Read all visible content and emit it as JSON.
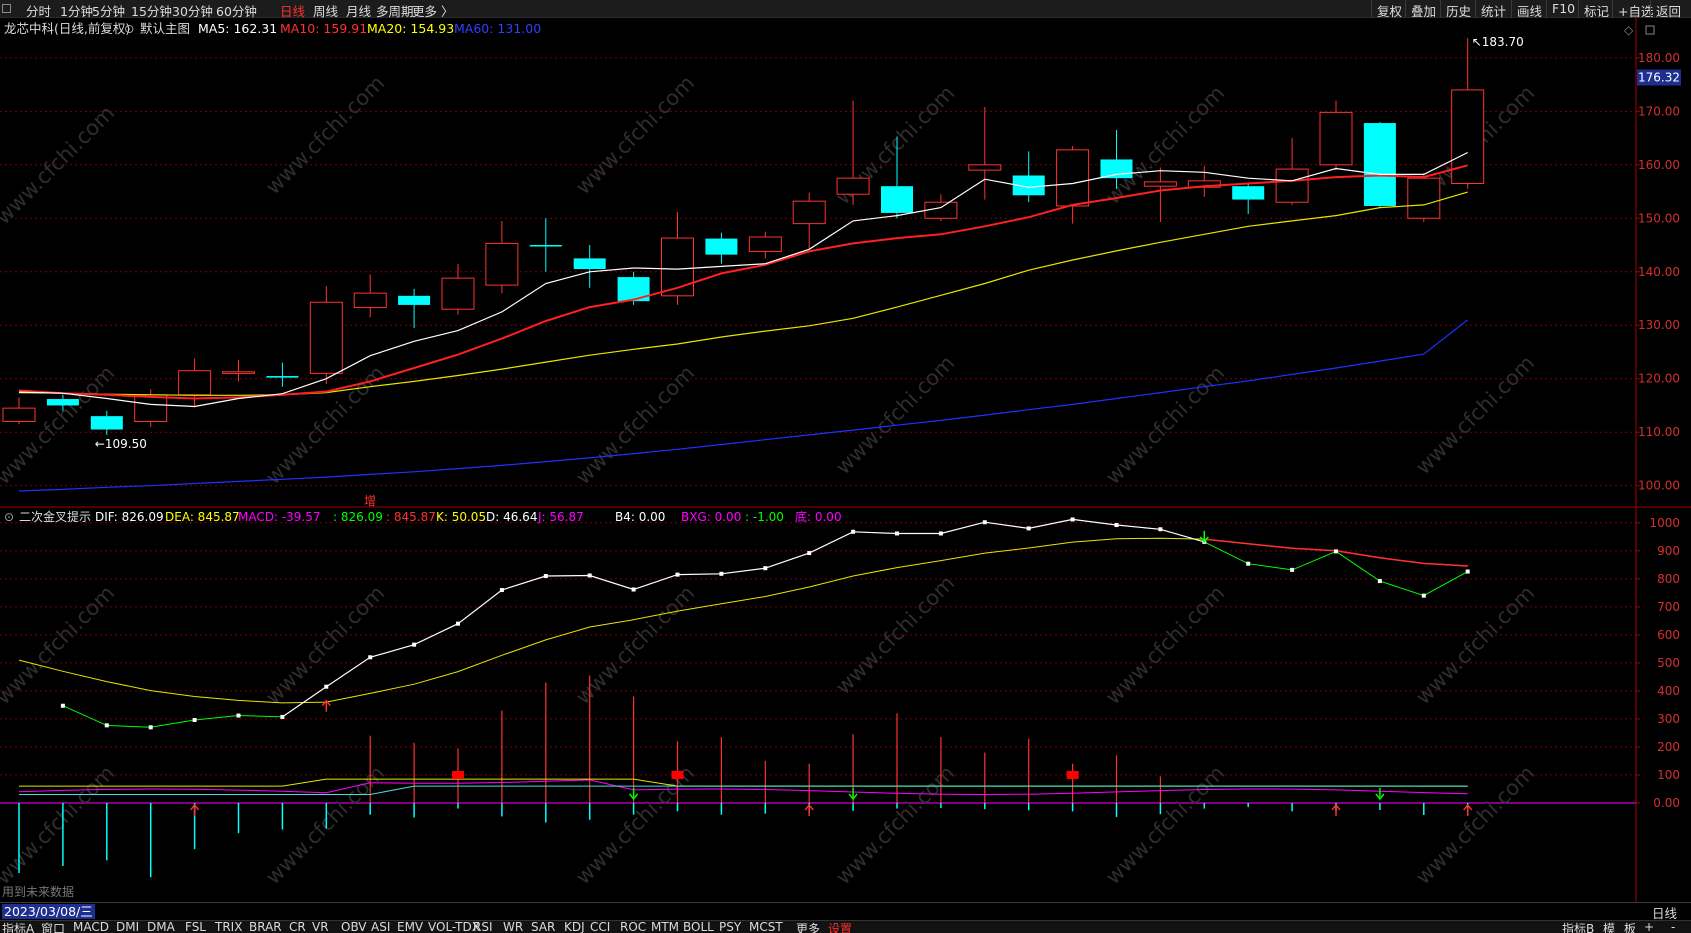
{
  "topbar": {
    "periods": [
      "分时",
      "1分钟",
      "5分钟",
      "15分钟",
      "30分钟",
      "60分钟",
      "日线",
      "周线",
      "月线",
      "多周期",
      "更多 〉"
    ],
    "active_period": "日线",
    "right_buttons": [
      "复权",
      "叠加",
      "历史",
      "统计",
      "画线",
      "F10",
      "标记",
      "+自选",
      "返回"
    ]
  },
  "main_header": {
    "title": "龙芯中科(日线,前复权)",
    "template": "默认主图",
    "ma5": "MA5: 162.31",
    "ma10": "MA10: 159.91",
    "ma20": "MA20: 154.93",
    "ma60": "MA60: 131.00"
  },
  "indicator_header": {
    "name": "二次金叉提示",
    "dif": "DIF: 826.09",
    "dea": "DEA: 845.87",
    "macd": "MACD: -39.57",
    "blank": ": 826.09",
    "blank2": ": 845.87",
    "k": "K: 50.05",
    "d": "D: 46.64",
    "j": "J: 56.87",
    "b4": "B4: 0.00",
    "bxg": "BXG: 0.00",
    "minus": ": -1.00",
    "die": "底: 0.00"
  },
  "zeng_label": "增",
  "future_label": "用到未来数据",
  "current_price": "176.32",
  "high_label": "183.70",
  "low_label": "109.50",
  "date": "2023/03/08/三",
  "period_right": "日线",
  "bottom_tabs": [
    "指标A",
    "窗口",
    "MACD",
    "DMI",
    "DMA",
    "FSL",
    "TRIX",
    "BRAR",
    "CR",
    "VR",
    "OBV",
    "ASI",
    "EMV",
    "VOL-TDX",
    "RSI",
    "WR",
    "SAR",
    "KDJ",
    "CCI",
    "ROC",
    "MTM",
    "BOLL",
    "PSY",
    "MCST",
    "更多",
    "设置"
  ],
  "bottom_right": [
    "指标B",
    "模",
    "板",
    "+",
    "-"
  ],
  "watermark": "www.cfchi.com",
  "colors": {
    "up": "#ff3232",
    "down": "#00ffff",
    "ma5": "#ffffff",
    "ma10": "#ff2020",
    "ma20": "#ffff00",
    "ma60": "#2030ff",
    "grid": "#7a0000",
    "macd_purple": "#ff00ff",
    "green": "#00ff00"
  },
  "chart_data": {
    "type": "candlestick",
    "price_axis": {
      "ticks": [
        "180.00",
        "170.00",
        "160.00",
        "150.00",
        "140.00",
        "130.00",
        "120.00",
        "110.00",
        "100.00"
      ],
      "ylim": [
        96.2,
        186.7
      ]
    },
    "indicator_axis": {
      "ticks": [
        "1000",
        "900",
        "800",
        "700",
        "600",
        "500",
        "400",
        "300",
        "200",
        "100",
        "0.00"
      ],
      "ylim": [
        -350,
        1060
      ]
    },
    "candles": [
      {
        "o": 112,
        "c": 114.5,
        "h": 116.5,
        "l": 111.5
      },
      {
        "o": 116.2,
        "c": 115,
        "h": 117,
        "l": 114
      },
      {
        "o": 113,
        "c": 110.5,
        "h": 114,
        "l": 109.5
      },
      {
        "o": 112,
        "c": 117,
        "h": 118,
        "l": 111
      },
      {
        "o": 117,
        "c": 121.5,
        "h": 123.8,
        "l": 114.6
      },
      {
        "o": 121,
        "c": 121.3,
        "h": 123.5,
        "l": 119.5
      },
      {
        "o": 120.5,
        "c": 120.2,
        "h": 123,
        "l": 118.5
      },
      {
        "o": 121,
        "c": 134.3,
        "h": 137.3,
        "l": 119
      },
      {
        "o": 133.3,
        "c": 136,
        "h": 139.5,
        "l": 131.5
      },
      {
        "o": 135.5,
        "c": 133.8,
        "h": 136.8,
        "l": 129.5
      },
      {
        "o": 133,
        "c": 138.8,
        "h": 141.5,
        "l": 132
      },
      {
        "o": 137.5,
        "c": 145.3,
        "h": 149.5,
        "l": 136
      },
      {
        "o": 145,
        "c": 144.8,
        "h": 150,
        "l": 140
      },
      {
        "o": 142.5,
        "c": 140.5,
        "h": 145,
        "l": 137
      },
      {
        "o": 139,
        "c": 134.5,
        "h": 140,
        "l": 133.8
      },
      {
        "o": 135.5,
        "c": 146.3,
        "h": 151.2,
        "l": 133.8
      },
      {
        "o": 146.2,
        "c": 143.2,
        "h": 147.3,
        "l": 141.5
      },
      {
        "o": 143.8,
        "c": 146.5,
        "h": 147.5,
        "l": 142.5
      },
      {
        "o": 149,
        "c": 153.2,
        "h": 154.8,
        "l": 144.3
      },
      {
        "o": 154.5,
        "c": 157.5,
        "h": 172,
        "l": 152.5
      },
      {
        "o": 156,
        "c": 151,
        "h": 165.3,
        "l": 150
      },
      {
        "o": 150,
        "c": 153,
        "h": 154.5,
        "l": 149.5
      },
      {
        "o": 159,
        "c": 160,
        "h": 170.8,
        "l": 153.5
      },
      {
        "o": 158,
        "c": 154.3,
        "h": 162.5,
        "l": 153
      },
      {
        "o": 152.3,
        "c": 162.8,
        "h": 163.5,
        "l": 149
      },
      {
        "o": 161,
        "c": 157.5,
        "h": 166.5,
        "l": 155.5
      },
      {
        "o": 156,
        "c": 156.8,
        "h": 159.5,
        "l": 149.3
      },
      {
        "o": 155.8,
        "c": 157,
        "h": 159.8,
        "l": 154
      },
      {
        "o": 156,
        "c": 153.5,
        "h": 156.5,
        "l": 150.8
      },
      {
        "o": 153,
        "c": 159.2,
        "h": 165,
        "l": 152.5
      },
      {
        "o": 160,
        "c": 169.8,
        "h": 172,
        "l": 159
      },
      {
        "o": 167.8,
        "c": 152.3,
        "h": 168,
        "l": 152
      },
      {
        "o": 150,
        "c": 157.5,
        "h": 158.5,
        "l": 149.3
      },
      {
        "o": 156.5,
        "c": 174,
        "h": 183.7,
        "l": 155.5
      }
    ],
    "ma5": [
      117.5,
      117.3,
      116.3,
      115.2,
      114.8,
      116.3,
      117.2,
      120,
      124.3,
      127,
      129,
      132.5,
      137.8,
      140,
      140.7,
      140.5,
      141,
      141.5,
      144.2,
      149.5,
      150.5,
      152,
      157.3,
      155.8,
      156.5,
      158.2,
      158.9,
      158.6,
      157.5,
      157,
      159.3,
      158.2,
      158.2,
      162.3
    ],
    "ma10": [
      117.8,
      117.3,
      117,
      116.6,
      116.3,
      116.5,
      117,
      117.6,
      119.5,
      122,
      124.5,
      127.5,
      130.8,
      133.4,
      134.8,
      137,
      139.7,
      141.3,
      143.8,
      145.3,
      146.3,
      147,
      148.5,
      150.2,
      152.5,
      153.8,
      155.2,
      156,
      156.5,
      157,
      157.7,
      158,
      157.7,
      159.9
    ],
    "ma20": [
      117.4,
      117.3,
      117.1,
      117,
      116.9,
      116.9,
      117,
      117.4,
      118.5,
      119.5,
      120.6,
      121.8,
      123.1,
      124.4,
      125.5,
      126.5,
      127.8,
      128.9,
      129.9,
      131.3,
      133.4,
      135.6,
      137.8,
      140.3,
      142.2,
      143.9,
      145.5,
      147,
      148.5,
      149.5,
      150.5,
      152,
      152.5,
      154.9
    ],
    "ma60": [
      99,
      99.3,
      99.7,
      100,
      100.4,
      100.8,
      101.2,
      101.6,
      102.1,
      102.6,
      103.2,
      103.8,
      104.5,
      105.2,
      106,
      106.8,
      107.7,
      108.6,
      109.5,
      110.4,
      111.3,
      112.2,
      113.2,
      114.2,
      115.2,
      116.3,
      117.4,
      118.5,
      119.6,
      120.8,
      122,
      123.3,
      124.6,
      131
    ],
    "dif": [
      null,
      347,
      277,
      270,
      296,
      312,
      307,
      415,
      520,
      565,
      640,
      760,
      810,
      812,
      762,
      815,
      818,
      838,
      892,
      968,
      962,
      962,
      1002,
      980,
      1012,
      992,
      977,
      932,
      854,
      832,
      898,
      792,
      740,
      826
    ],
    "dea": [
      510,
      470,
      433,
      401,
      380,
      366,
      357,
      360,
      391,
      424,
      469,
      527,
      582,
      628,
      654,
      685,
      711,
      737,
      771,
      810,
      840,
      865,
      892,
      910,
      931,
      943,
      945,
      942,
      925,
      909,
      900,
      875,
      855,
      846
    ],
    "macd_bars": [
      -250,
      -225,
      -205,
      -265,
      -165,
      -108,
      -95,
      -91,
      -42,
      -52,
      -20,
      -48,
      -70,
      -60,
      -42,
      -30,
      -42,
      -38,
      -35,
      -28,
      -20,
      -18,
      -22,
      -26,
      -30,
      -50,
      -40,
      -20,
      -15,
      -30,
      -30,
      -25,
      -43,
      -39.57
    ],
    "vol_bars": [
      0,
      0,
      0,
      0,
      0,
      0,
      0,
      0,
      240,
      215,
      195,
      330,
      430,
      455,
      380,
      220,
      235,
      150,
      140,
      245,
      320,
      235,
      180,
      230,
      140,
      170,
      95,
      0,
      0,
      0,
      0,
      0,
      0,
      0
    ]
  }
}
